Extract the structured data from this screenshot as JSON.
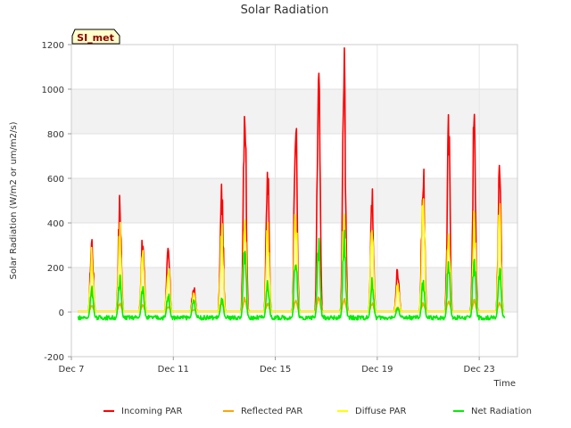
{
  "chart_data": {
    "type": "line",
    "title": "Solar Radiation",
    "xlabel": "Time",
    "ylabel": "Solar Radiation (W/m2 or um/m2/s)",
    "ylim": [
      -200,
      1200
    ],
    "xlim": [
      0,
      17.5
    ],
    "yticks": [
      -200,
      0,
      200,
      400,
      600,
      800,
      1000,
      1200
    ],
    "xticks": [
      {
        "x": 0,
        "label": "Dec 7"
      },
      {
        "x": 4,
        "label": "Dec 11"
      },
      {
        "x": 8,
        "label": "Dec 15"
      },
      {
        "x": 12,
        "label": "Dec 19"
      },
      {
        "x": 16,
        "label": "Dec 23"
      }
    ],
    "badge": "SI_met",
    "legend_position": "bottom",
    "grid": true,
    "series": [
      {
        "name": "Incoming PAR",
        "color": "#ff0000",
        "peaks": [
          [
            0.8,
            330
          ],
          [
            1.9,
            490
          ],
          [
            2.8,
            330
          ],
          [
            3.8,
            270
          ],
          [
            4.8,
            110
          ],
          [
            5.9,
            540
          ],
          [
            6.8,
            1020
          ],
          [
            7.7,
            620
          ],
          [
            8.8,
            860
          ],
          [
            9.7,
            1040
          ],
          [
            10.7,
            1110
          ],
          [
            11.8,
            490
          ],
          [
            12.8,
            200
          ],
          [
            13.8,
            640
          ],
          [
            14.8,
            810
          ],
          [
            15.8,
            860
          ],
          [
            16.8,
            650
          ]
        ]
      },
      {
        "name": "Reflected PAR",
        "color": "#ffa500",
        "peaks": [
          [
            0.8,
            30
          ],
          [
            1.9,
            40
          ],
          [
            2.8,
            30
          ],
          [
            3.8,
            25
          ],
          [
            4.8,
            10
          ],
          [
            5.9,
            45
          ],
          [
            6.8,
            60
          ],
          [
            7.7,
            40
          ],
          [
            8.8,
            50
          ],
          [
            9.7,
            70
          ],
          [
            10.7,
            60
          ],
          [
            11.8,
            40
          ],
          [
            12.8,
            20
          ],
          [
            13.8,
            40
          ],
          [
            14.8,
            55
          ],
          [
            15.8,
            55
          ],
          [
            16.8,
            45
          ]
        ]
      },
      {
        "name": "Diffuse PAR",
        "color": "#ffff00",
        "peaks": [
          [
            0.8,
            260
          ],
          [
            1.9,
            370
          ],
          [
            2.8,
            260
          ],
          [
            3.8,
            200
          ],
          [
            4.8,
            80
          ],
          [
            5.9,
            370
          ],
          [
            6.8,
            400
          ],
          [
            7.7,
            380
          ],
          [
            8.8,
            450
          ],
          [
            9.7,
            300
          ],
          [
            10.7,
            460
          ],
          [
            11.8,
            360
          ],
          [
            12.8,
            120
          ],
          [
            13.8,
            500
          ],
          [
            14.8,
            350
          ],
          [
            15.8,
            420
          ],
          [
            16.8,
            440
          ]
        ]
      },
      {
        "name": "Net Radiation",
        "color": "#00ee00",
        "peaks": [
          [
            0.8,
            100
          ],
          [
            1.9,
            160
          ],
          [
            2.8,
            110
          ],
          [
            3.8,
            80
          ],
          [
            4.8,
            60
          ],
          [
            5.9,
            60
          ],
          [
            6.8,
            300
          ],
          [
            7.7,
            130
          ],
          [
            8.8,
            280
          ],
          [
            9.7,
            320
          ],
          [
            10.7,
            330
          ],
          [
            11.8,
            140
          ],
          [
            12.8,
            20
          ],
          [
            13.8,
            140
          ],
          [
            14.8,
            230
          ],
          [
            15.8,
            250
          ],
          [
            16.8,
            200
          ]
        ],
        "night_level": -25
      }
    ]
  }
}
